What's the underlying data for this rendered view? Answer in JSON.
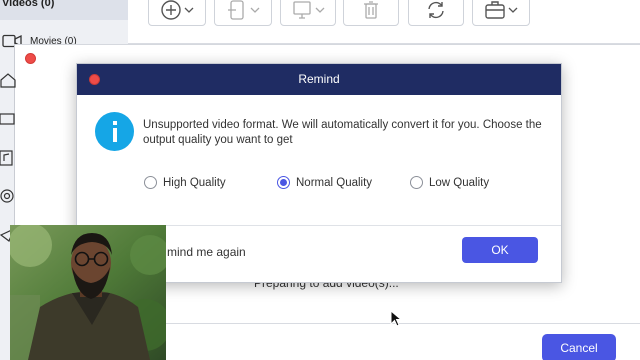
{
  "sidebar": {
    "videos_label": "Videos (0)",
    "movies_label": "Movies (0)"
  },
  "toolbar": {
    "buttons": [
      "add-icon",
      "device-icon",
      "monitor-icon",
      "trash-icon",
      "refresh-icon",
      "toolbox-icon"
    ]
  },
  "main": {
    "status_text": "Preparing to add video(s)...",
    "cancel_label": "Cancel"
  },
  "dialog": {
    "title": "Remind",
    "message": "Unsupported video format. We will automatically convert it for you. Choose the output quality you want to get",
    "options": [
      {
        "label": "High Quality",
        "selected": false
      },
      {
        "label": "Normal Quality",
        "selected": true
      },
      {
        "label": "Low Quality",
        "selected": false
      }
    ],
    "remind_text": "mind me again",
    "ok_label": "OK"
  },
  "colors": {
    "title_bar": "#1f2c63",
    "accent": "#4a56e3",
    "info": "#15a6e6",
    "close_dot": "#ee4c48"
  }
}
